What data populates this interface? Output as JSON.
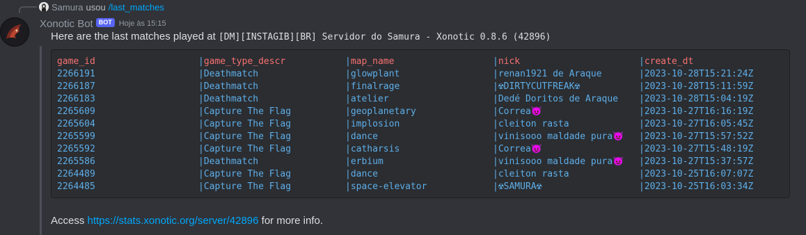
{
  "reply": {
    "user": "Samura",
    "used": "usou",
    "command": "/last_matches"
  },
  "author": {
    "name": "Xonotic Bot",
    "badge": "BOT",
    "timestamp": "Hoje às 15:15"
  },
  "intro": {
    "prefix": "Here are the last matches played at ",
    "server": "[DM][INSTAGIB][BR] Servidor do Samura - Xonotic 0.8.6 (42896)"
  },
  "table": {
    "headers": [
      "game_id",
      "game_type_descr",
      "map_name",
      "nick",
      "create_dt"
    ],
    "rows": [
      [
        "2266191",
        "Deathmatch",
        "glowplant",
        "renan1921 de Araque",
        "2023-10-28T15:21:24Z"
      ],
      [
        "2266187",
        "Deathmatch",
        "finalrage",
        "☢DIRTYCUTFREAK☢",
        "2023-10-28T15:11:59Z"
      ],
      [
        "2266183",
        "Deathmatch",
        "atelier",
        "Dedé Doritos de Araque",
        "2023-10-28T15:04:19Z"
      ],
      [
        "2265609",
        "Capture The Flag",
        "geoplanetary",
        "Correa😈",
        "2023-10-27T16:16:19Z"
      ],
      [
        "2265604",
        "Capture The Flag",
        "implosion",
        "cleiton rasta",
        "2023-10-27T16:05:45Z"
      ],
      [
        "2265599",
        "Capture The Flag",
        "dance",
        "vinisooo maldade pura😈",
        "2023-10-27T15:57:52Z"
      ],
      [
        "2265592",
        "Capture The Flag",
        "catharsis",
        "Correa😈",
        "2023-10-27T15:48:19Z"
      ],
      [
        "2265586",
        "Deathmatch",
        "erbium",
        "vinisooo maldade pura😈",
        "2023-10-27T15:37:57Z"
      ],
      [
        "2264489",
        "Capture The Flag",
        "dance",
        "cleiton rasta",
        "2023-10-25T16:07:07Z"
      ],
      [
        "2264485",
        "Capture The Flag",
        "space-elevator",
        "☢SAMURA☢",
        "2023-10-25T16:03:34Z"
      ]
    ]
  },
  "footer": {
    "prefix": "Access ",
    "link": "https://stats.xonotic.org/server/42896",
    "suffix": " for more info."
  },
  "colors": {
    "background": "#313338",
    "codeblock": "#2b2d31",
    "header_text": "#f87171",
    "cell_text": "#5eaee8",
    "link": "#00a8fc",
    "badge": "#5865f2"
  }
}
